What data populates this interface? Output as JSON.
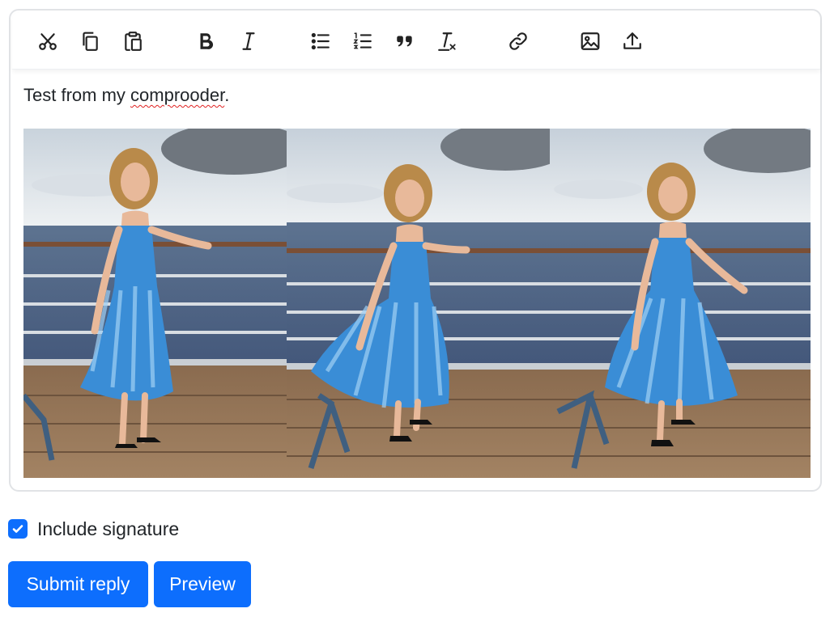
{
  "toolbar": {
    "groups": [
      [
        "cut-icon",
        "copy-icon",
        "paste-icon"
      ],
      [
        "bold-icon",
        "italic-icon"
      ],
      [
        "bullet-list-icon",
        "numbered-list-icon",
        "quote-icon",
        "clear-format-icon"
      ],
      [
        "link-icon"
      ],
      [
        "image-icon",
        "upload-icon"
      ]
    ]
  },
  "editor": {
    "text_before": "Test from my ",
    "misspelled_word": "comprooder",
    "text_after": "."
  },
  "signature": {
    "label": "Include signature",
    "checked": true
  },
  "buttons": {
    "submit": "Submit reply",
    "preview": "Preview"
  },
  "colors": {
    "accent": "#0d6efd",
    "border": "#e1e3e6",
    "text": "#212529",
    "spellcheck": "#e02020"
  }
}
